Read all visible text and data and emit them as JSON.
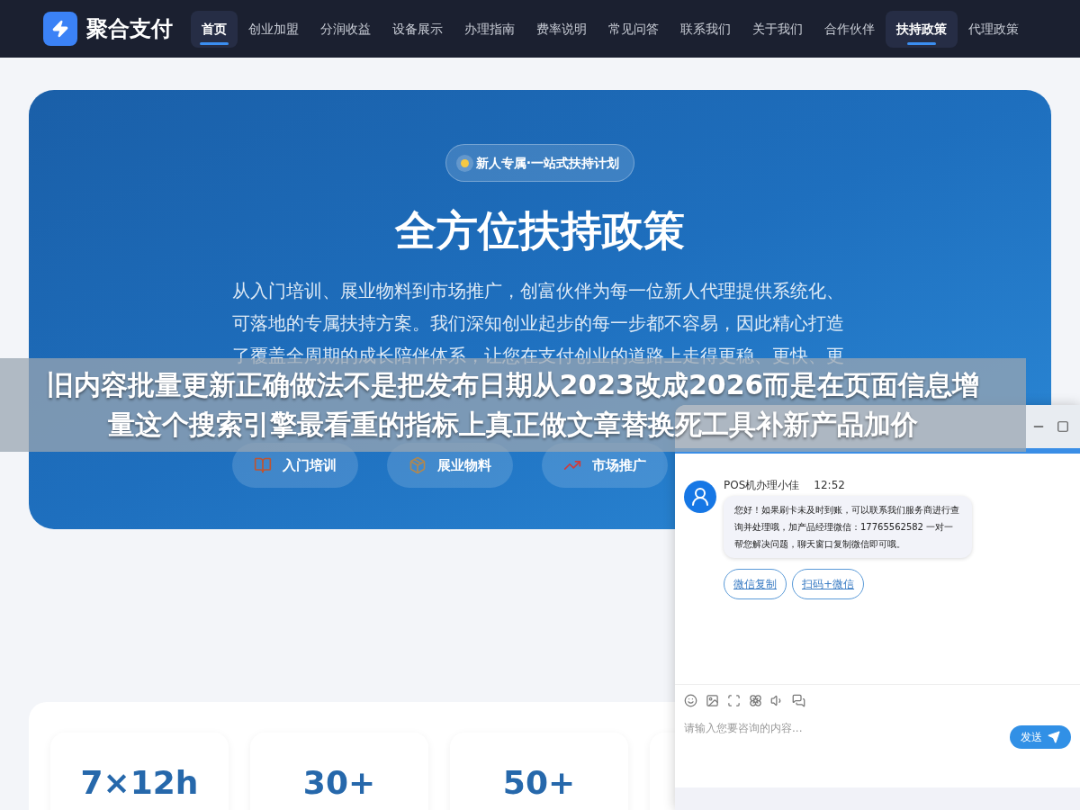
{
  "nav": {
    "logo_text": "聚合支付",
    "items": [
      {
        "label": "首页",
        "selected": true
      },
      {
        "label": "创业加盟",
        "selected": false
      },
      {
        "label": "分润收益",
        "selected": false
      },
      {
        "label": "设备展示",
        "selected": false
      },
      {
        "label": "办理指南",
        "selected": false
      },
      {
        "label": "费率说明",
        "selected": false
      },
      {
        "label": "常见问答",
        "selected": false
      },
      {
        "label": "联系我们",
        "selected": false
      },
      {
        "label": "关于我们",
        "selected": false
      },
      {
        "label": "合作伙伴",
        "selected": false
      },
      {
        "label": "扶持政策",
        "selected": true
      },
      {
        "label": "代理政策",
        "selected": false
      }
    ]
  },
  "hero": {
    "badge": "新人专属·一站式扶持计划",
    "title": "全方位扶持政策",
    "description": "从入门培训、展业物料到市场推广，创富伙伴为每一位新人代理提供系统化、可落地的专属扶持方案。我们深知创业起步的每一步都不容易，因此精心打造了覆盖全周期的成长陪伴体系，让您在支付创业的道路上走得更稳、更快、更",
    "features": [
      {
        "kind": "books",
        "label": "入门培训"
      },
      {
        "kind": "box",
        "label": "展业物料"
      },
      {
        "kind": "chart",
        "label": "市场推广"
      }
    ]
  },
  "stats": [
    {
      "value": "7×12h"
    },
    {
      "value": "30+"
    },
    {
      "value": "50+"
    }
  ],
  "overlay_banner": {
    "text": "旧内容批量更新正确做法不是把发布日期从2023改成2026而是在页面信息增量这个搜索引擎最看重的指标上真正做文章替换死工具补新产品加价"
  },
  "chat": {
    "agent_name": "POS机办理小佳",
    "time": "12:52",
    "message": "您好！如果刷卡未及时到账，可以联系我们服务商进行查询并处理哦，加产品经理微信：17765562582 一对一帮您解决问题，聊天窗口复制微信即可哦。",
    "quick_replies": [
      "微信复制",
      "扫码+微信"
    ],
    "input_placeholder": "请输入您要咨询的内容...",
    "send_label": "发送"
  }
}
